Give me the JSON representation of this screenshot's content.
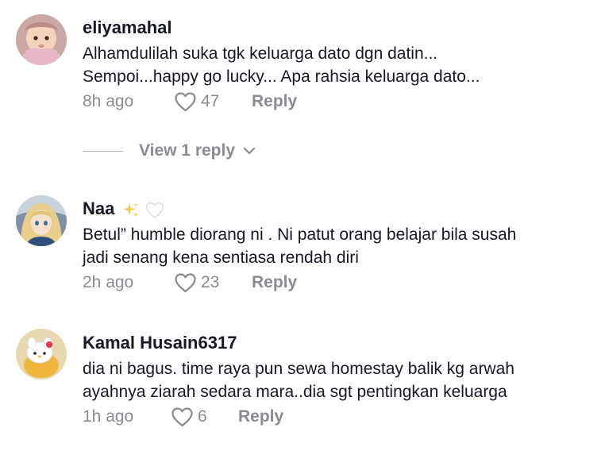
{
  "comments": [
    {
      "username": "eliyamahal",
      "lines": [
        "Alhamdulilah suka tgk keluarga dato dgn datin...",
        "Sempoi...happy go lucky... Apa rahsia keluarga dato..."
      ],
      "time": "8h ago",
      "likes": "47",
      "reply_label": "Reply",
      "view_replies_label": "View 1 reply"
    },
    {
      "username": "Naa",
      "username_emojis": [
        "sparkles-icon",
        "white-heart-icon"
      ],
      "lines": [
        "Betul” humble diorang ni . Ni patut orang belajar bila susah",
        "jadi senang kena sentiasa rendah diri"
      ],
      "time": "2h ago",
      "likes": "23",
      "reply_label": "Reply"
    },
    {
      "username": "Kamal Husain6317",
      "lines": [
        "dia ni bagus. time raya pun sewa homestay balik kg arwah",
        "ayahnya ziarah sedara mara..dia sgt pentingkan keluarga"
      ],
      "time": "1h ago",
      "likes": "6",
      "reply_label": "Reply"
    }
  ],
  "colors": {
    "text_primary": "#161823",
    "text_secondary": "#8a8b91",
    "divider": "#b9babd"
  }
}
